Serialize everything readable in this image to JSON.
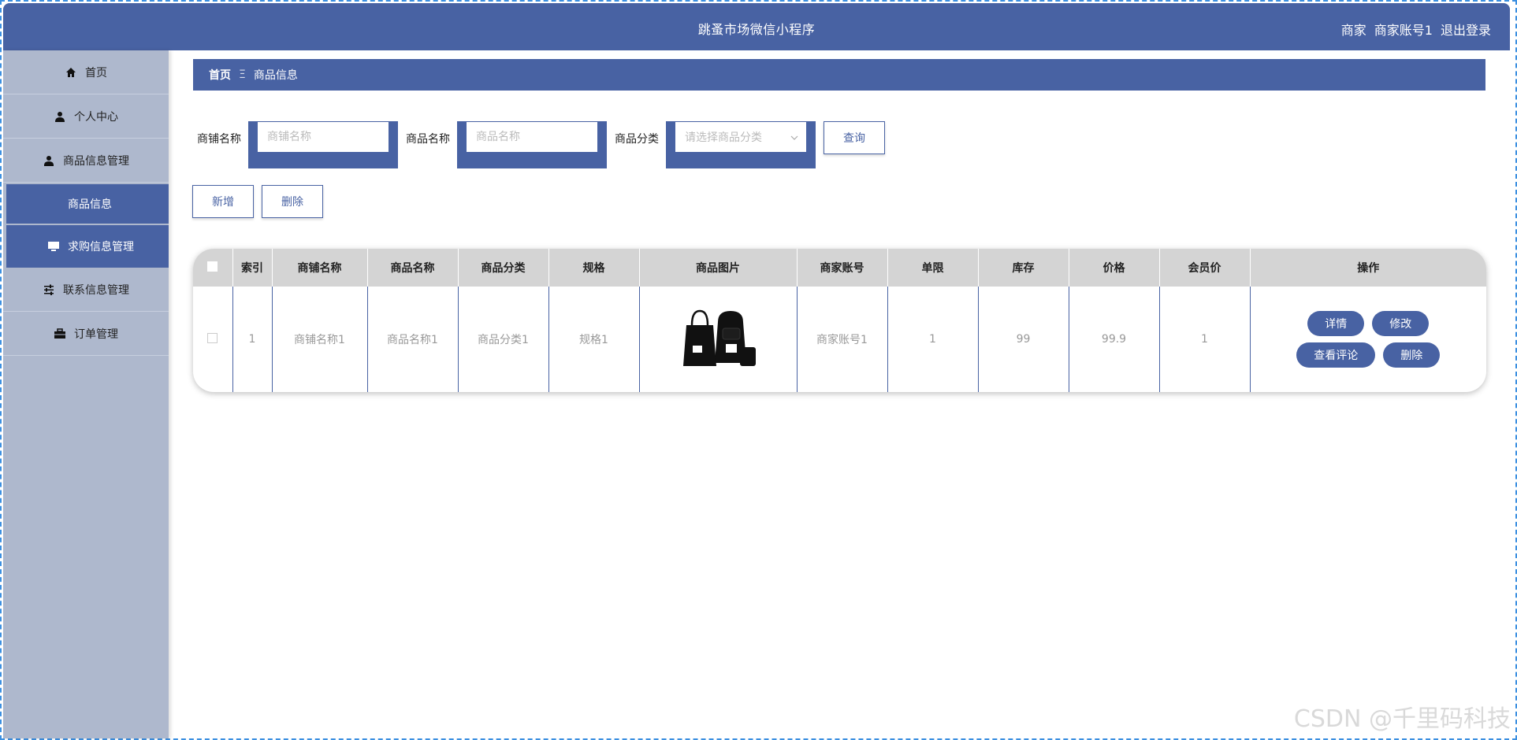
{
  "header": {
    "title": "跳蚤市场微信小程序",
    "role": "商家",
    "account": "商家账号1",
    "logout": "退出登录"
  },
  "sidebar": {
    "items": [
      {
        "label": "首页",
        "icon": "home-icon"
      },
      {
        "label": "个人中心",
        "icon": "user-icon"
      },
      {
        "label": "商品信息管理",
        "icon": "user-icon"
      },
      {
        "label": "商品信息",
        "icon": ""
      },
      {
        "label": "求购信息管理",
        "icon": "monitor-icon"
      },
      {
        "label": "联系信息管理",
        "icon": "sliders-icon"
      },
      {
        "label": "订单管理",
        "icon": "briefcase-icon"
      }
    ]
  },
  "breadcrumb": {
    "home": "首页",
    "separator": "Ξ",
    "current": "商品信息"
  },
  "search": {
    "shop_label": "商铺名称",
    "shop_placeholder": "商铺名称",
    "name_label": "商品名称",
    "name_placeholder": "商品名称",
    "category_label": "商品分类",
    "category_placeholder": "请选择商品分类",
    "query_label": "查询"
  },
  "actions": {
    "add_label": "新增",
    "delete_label": "删除"
  },
  "table": {
    "headers": [
      "索引",
      "商铺名称",
      "商品名称",
      "商品分类",
      "规格",
      "商品图片",
      "商家账号",
      "单限",
      "库存",
      "价格",
      "会员价",
      "操作"
    ],
    "rows": [
      {
        "index": "1",
        "shop": "商铺名称1",
        "name": "商品名称1",
        "category": "商品分类1",
        "spec": "规格1",
        "account": "商家账号1",
        "limit": "1",
        "stock": "99",
        "price": "99.9",
        "member_price": "1",
        "ops": {
          "detail": "详情",
          "edit": "修改",
          "reviews": "查看评论",
          "delete": "删除"
        }
      }
    ]
  },
  "watermark": "CSDN @千里码科技",
  "colors": {
    "primary": "#4862a3",
    "sidebar": "#aeb8cd",
    "header_row": "#d4d4d4"
  }
}
